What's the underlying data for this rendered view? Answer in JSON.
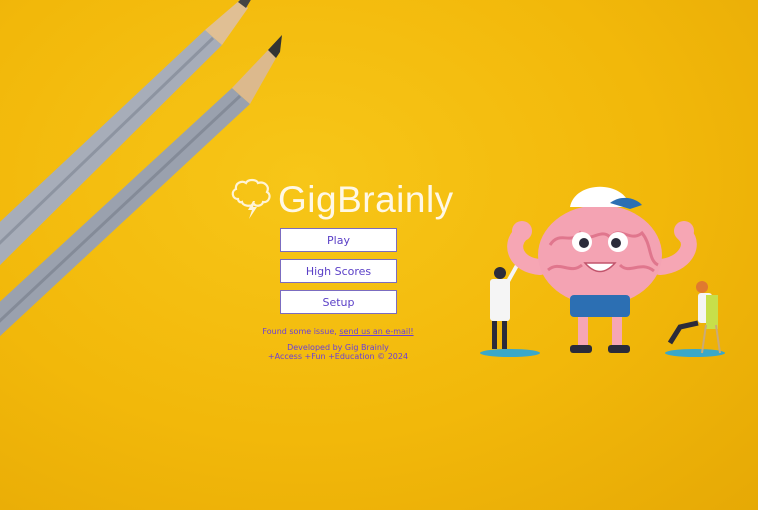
{
  "app": {
    "name": "GigBrainly"
  },
  "menu": {
    "play": "Play",
    "high_scores": "High Scores",
    "setup": "Setup"
  },
  "footer": {
    "issue_text": "Found some issue, ",
    "issue_link": "send us an e-mail!",
    "developer": "Developed by Gig Brainly",
    "tagline": "+Access +Fun +Education © 2024"
  },
  "colors": {
    "background": "#f2b80a",
    "button_text": "#5a3fc7",
    "footer_text": "#6a3fd8",
    "logo_text": "#fff8e6"
  },
  "icons": {
    "logo": "brain-lightning-icon"
  }
}
